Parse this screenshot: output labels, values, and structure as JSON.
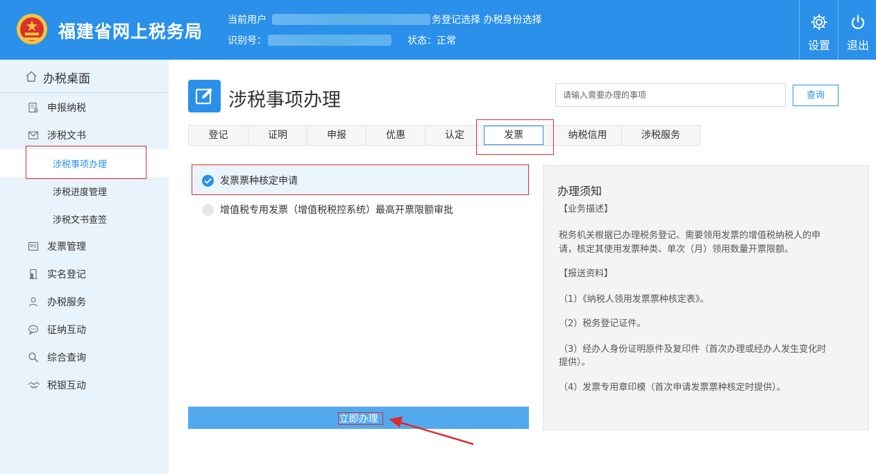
{
  "header": {
    "site_title": "福建省网上税务局",
    "current_user_label": "当前用户",
    "links_text": "务登记选择  办税身份选择",
    "id_label": "识别号：",
    "status_text": "状态：正常",
    "settings_label": "设置",
    "logout_label": "退出"
  },
  "sidebar": {
    "home": "办税桌面",
    "items": [
      {
        "label": "申报纳税",
        "icon": "report-icon"
      },
      {
        "label": "涉税文书",
        "icon": "mail-icon"
      }
    ],
    "subitems": [
      {
        "label": "涉税事项办理"
      },
      {
        "label": "涉税进度管理"
      },
      {
        "label": "涉税文书查签"
      }
    ],
    "items2": [
      {
        "label": "发票管理",
        "icon": "invoice-icon"
      },
      {
        "label": "实名登记",
        "icon": "door-icon"
      },
      {
        "label": "办税服务",
        "icon": "person-icon"
      },
      {
        "label": "征纳互动",
        "icon": "chat-icon"
      },
      {
        "label": "综合查询",
        "icon": "search-icon"
      },
      {
        "label": "税银互动",
        "icon": "handshake-icon"
      }
    ]
  },
  "main": {
    "page_title": "涉税事项办理",
    "search_placeholder": "请输入需要办理的事项",
    "search_button": "查询",
    "tabs": [
      {
        "label": "登记"
      },
      {
        "label": "证明"
      },
      {
        "label": "申报"
      },
      {
        "label": "优惠"
      },
      {
        "label": "认定"
      },
      {
        "label": "发票"
      },
      {
        "label": "纳税信用"
      },
      {
        "label": "涉税服务"
      }
    ],
    "options": [
      {
        "label": "发票票种核定申请"
      },
      {
        "label": "增值税专用发票（增值税税控系统）最高开票限额审批"
      }
    ],
    "submit_label": "立即办理"
  },
  "notice": {
    "title": "办理须知",
    "lines": [
      "【业务描述】",
      "税务机关根据已办理税务登记、需要领用发票的增值税纳税人的申",
      "请，核定其使用发票种类、单次（月）领用数量开票限额。",
      "【报送资料】",
      "（1）《纳税人领用发票票种核定表》。",
      "（2）税务登记证件。",
      "（3）经办人身份证明原件及复印件（首次办理或经办人发生变化时",
      "提供）。",
      "（4）发票专用章印模（首次申请发票票种核定时提供）。"
    ]
  },
  "colors": {
    "brand_blue": "#2a90ea",
    "annotation_red": "#e02a2a"
  }
}
